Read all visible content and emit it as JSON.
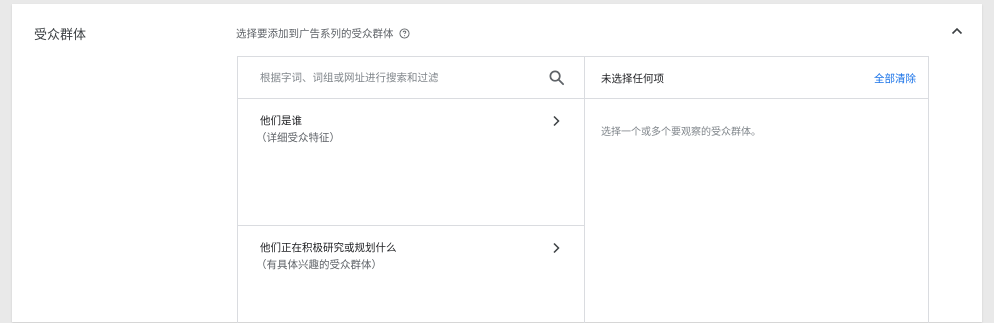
{
  "section": {
    "title": "受众群体",
    "instruction": "选择要添加到广告系列的受众群体",
    "help_icon": "help-circle-icon",
    "collapse_icon": "chevron-up-icon"
  },
  "browse": {
    "search_placeholder": "根据字词、词组或网址进行搜索和过滤",
    "search_icon": "search-icon",
    "categories": [
      {
        "title": "他们是谁",
        "subtitle": "（详细受众特征）",
        "icon": "chevron-right-icon"
      },
      {
        "title": "他们正在积极研究或规划什么",
        "subtitle": "（有具体兴趣的受众群体）",
        "icon": "chevron-right-icon"
      }
    ]
  },
  "selection": {
    "header": "未选择任何项",
    "clear_all": "全部清除",
    "empty_hint": "选择一个或多个要观察的受众群体。"
  },
  "colors": {
    "link": "#1a73e8",
    "border": "#dadce0",
    "background": "#e9e9e9"
  }
}
